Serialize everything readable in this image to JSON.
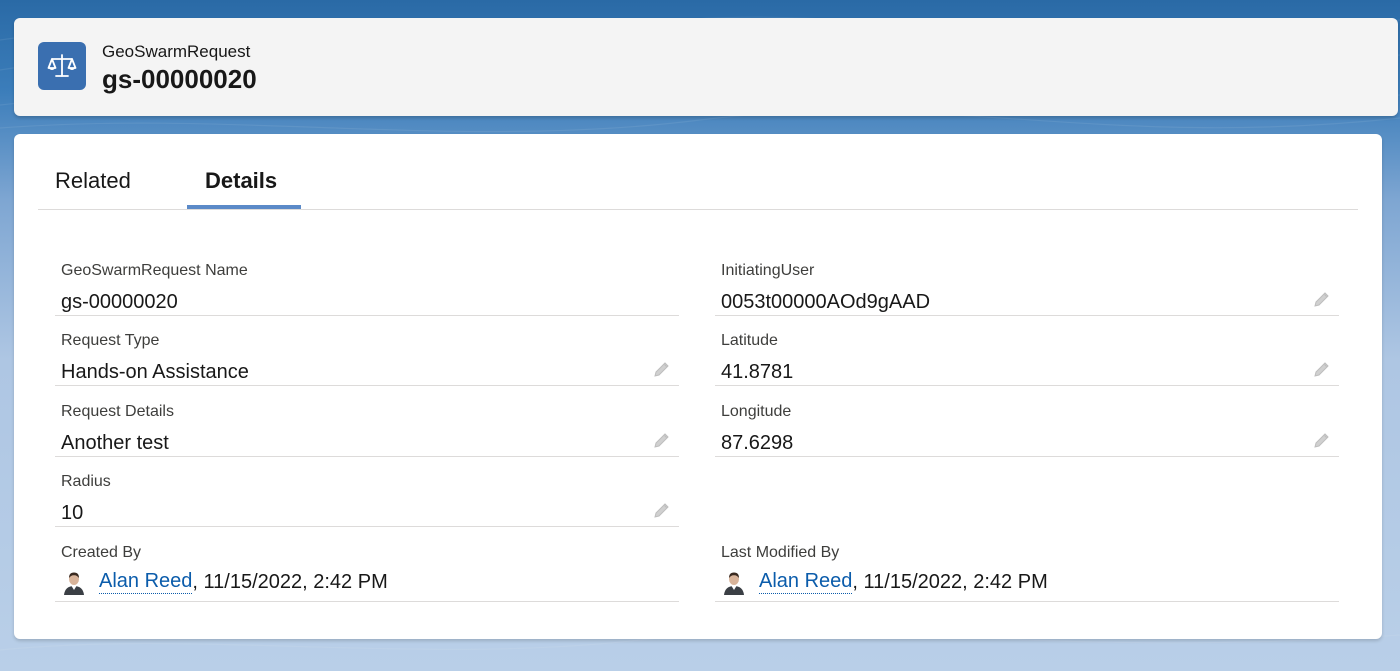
{
  "header": {
    "object_type": "GeoSwarmRequest",
    "record_name": "gs-00000020",
    "icon": "scales-icon",
    "icon_color": "#3a6fb0"
  },
  "tabs": [
    {
      "label": "Related",
      "active": false
    },
    {
      "label": "Details",
      "active": true
    }
  ],
  "fields": {
    "name": {
      "label": "GeoSwarmRequest Name",
      "value": "gs-00000020"
    },
    "initiating_user": {
      "label": "InitiatingUser",
      "value": "0053t00000AOd9gAAD"
    },
    "request_type": {
      "label": "Request Type",
      "value": "Hands-on Assistance"
    },
    "latitude": {
      "label": "Latitude",
      "value": "41.8781"
    },
    "request_details": {
      "label": "Request Details",
      "value": "Another test"
    },
    "longitude": {
      "label": "Longitude",
      "value": "87.6298"
    },
    "radius": {
      "label": "Radius",
      "value": "10"
    },
    "created_by": {
      "label": "Created By",
      "user": "Alan Reed",
      "date": ", 11/15/2022, 2:42 PM"
    },
    "last_modified_by": {
      "label": "Last Modified By",
      "user": "Alan Reed",
      "date": ", 11/15/2022, 2:42 PM"
    }
  },
  "colors": {
    "accent": "#5b8ac8",
    "link": "#0b5cab",
    "edit_icon": "#c9c9c9"
  }
}
